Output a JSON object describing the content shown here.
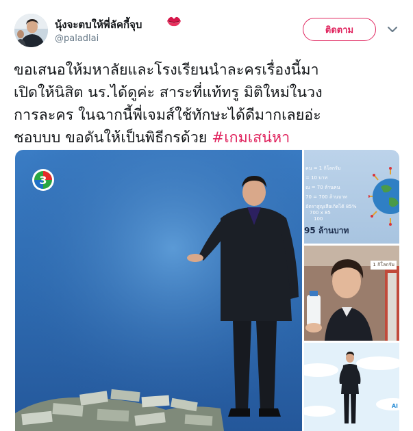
{
  "user": {
    "display_name": "นุ้งจะตบให้พี่ลัคกี้จุบ",
    "handle": "@paladlai",
    "emoji_icon": "kiss-mark-icon"
  },
  "follow_button": {
    "label": "ติดตาม"
  },
  "menu": {
    "icon": "chevron-down-icon"
  },
  "tweet": {
    "lines": [
      "ขอเสนอให้มหาลัยและโรงเรียนนำละครเรื่องนี้มา",
      "เปิดให้นิสิต นร.ได้ดูค่ะ สาระที่แท้ทรู มิติใหม่ในวง",
      "การละคร ในฉากนี้พี่เจมส์ใช้ทักษะได้ดีมากเลยอ่ะ"
    ],
    "last_line_text": "ชอบบบ ขอดันให้เป็นพิธีกรด้วย ",
    "hashtag": "#เกมเสน่หา"
  },
  "media": {
    "main_logo": "channel-3-logo",
    "thumb1": {
      "rows": [
        "คน = 1 กิโลกรัม",
        "= 10 บาท",
        "ณ = 70 ล้านคน",
        "70 = 700 ล้านบาท",
        "อัตราสูญเสียเกิดได้ 85%",
        "700 x 85",
        "100"
      ],
      "big_text": "95 ล้านบาท"
    },
    "thumb2": {
      "sign": "1 กิโลกรัม"
    },
    "thumb3": {
      "mark": "AI"
    }
  },
  "colors": {
    "accent": "#e0245e",
    "text": "#14171a",
    "muted": "#657786"
  }
}
